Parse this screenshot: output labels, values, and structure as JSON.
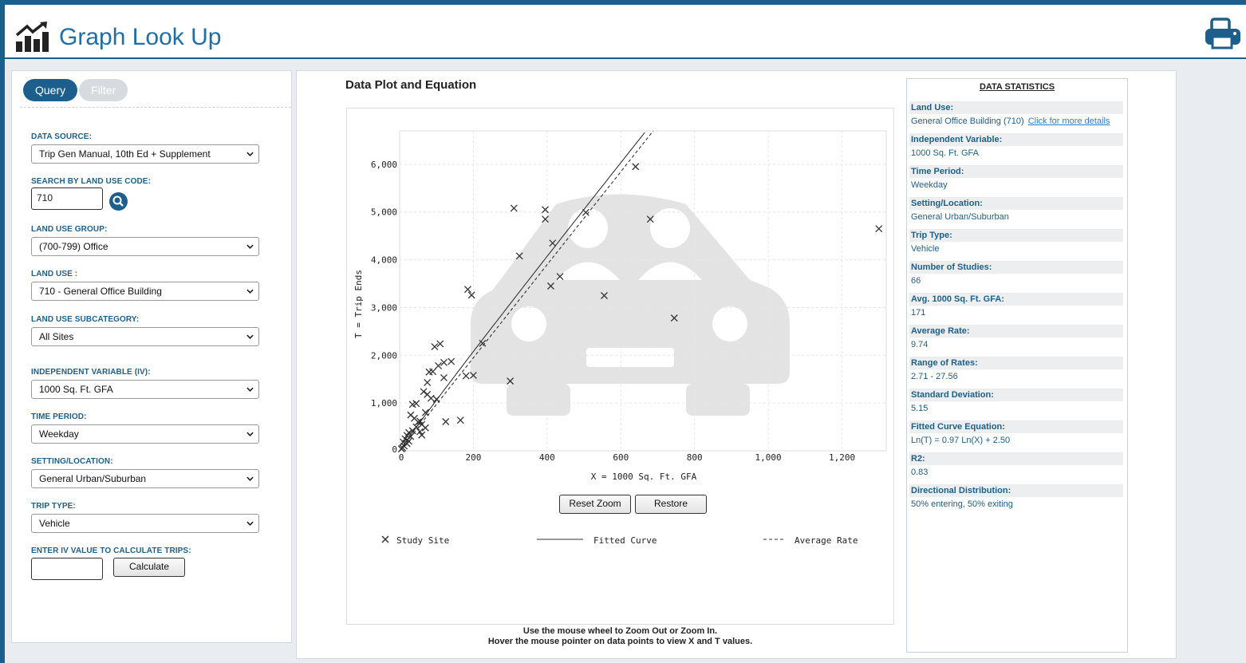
{
  "app": {
    "title": "Graph Look Up"
  },
  "tabs": {
    "query": "Query",
    "filter": "Filter"
  },
  "form": {
    "data_source": {
      "label": "DATA SOURCE:",
      "value": "Trip Gen Manual, 10th Ed + Supplement"
    },
    "search_code": {
      "label": "SEARCH BY LAND USE CODE:",
      "value": "710"
    },
    "land_use_group": {
      "label": "LAND USE GROUP:",
      "value": "(700-799) Office"
    },
    "land_use": {
      "label": "LAND USE :",
      "value": "710 - General Office Building"
    },
    "subcategory": {
      "label": "LAND USE SUBCATEGORY:",
      "value": "All Sites"
    },
    "iv": {
      "label": "INDEPENDENT VARIABLE (IV):",
      "value": "1000 Sq. Ft. GFA"
    },
    "time_period": {
      "label": "TIME PERIOD:",
      "value": "Weekday"
    },
    "setting": {
      "label": "SETTING/LOCATION:",
      "value": "General Urban/Suburban"
    },
    "trip_type": {
      "label": "TRIP TYPE:",
      "value": "Vehicle"
    },
    "iv_value": {
      "label": "ENTER IV VALUE TO CALCULATE TRIPS:",
      "value": ""
    },
    "calculate": "Calculate"
  },
  "plot": {
    "title": "Data Plot and Equation",
    "reset_zoom": "Reset Zoom",
    "restore": "Restore",
    "legend": {
      "study_site": "Study Site",
      "fitted_curve": "Fitted Curve",
      "average_rate": "Average Rate"
    },
    "hint1": "Use the mouse wheel to Zoom Out or Zoom In.",
    "hint2": "Hover the mouse pointer on data points to view X and T values."
  },
  "chart_data": {
    "type": "scatter",
    "xlabel": "X = 1000 Sq. Ft. GFA",
    "ylabel": "T = Trip Ends",
    "xlim": [
      0,
      1320
    ],
    "ylim": [
      0,
      6700
    ],
    "xticks": [
      0,
      200,
      400,
      600,
      800,
      1000,
      1200
    ],
    "xtick_labels": [
      "0",
      "200",
      "400",
      "600",
      "800",
      "1,000",
      "1,200"
    ],
    "yticks": [
      0,
      1000,
      2000,
      3000,
      4000,
      5000,
      6000
    ],
    "ytick_labels": [
      "0",
      "1,000",
      "2,000",
      "3,000",
      "4,000",
      "5,000",
      "6,000"
    ],
    "grid": true,
    "series": [
      {
        "name": "Study Site",
        "marker": "x",
        "points": [
          [
            1300,
            4650
          ],
          [
            640,
            5950
          ],
          [
            680,
            4850
          ],
          [
            310,
            5080
          ],
          [
            395,
            5050
          ],
          [
            395,
            4850
          ],
          [
            415,
            4350
          ],
          [
            505,
            4990
          ],
          [
            325,
            4080
          ],
          [
            435,
            3650
          ],
          [
            410,
            3450
          ],
          [
            555,
            3250
          ],
          [
            745,
            2780
          ],
          [
            185,
            3380
          ],
          [
            195,
            3260
          ],
          [
            225,
            2250
          ],
          [
            180,
            1570
          ],
          [
            200,
            1580
          ],
          [
            300,
            1460
          ],
          [
            165,
            640
          ],
          [
            125,
            610
          ],
          [
            95,
            2180
          ],
          [
            110,
            2240
          ],
          [
            120,
            1850
          ],
          [
            140,
            1870
          ],
          [
            105,
            1780
          ],
          [
            90,
            1660
          ],
          [
            80,
            1650
          ],
          [
            120,
            1530
          ],
          [
            75,
            1430
          ],
          [
            65,
            1240
          ],
          [
            75,
            1180
          ],
          [
            100,
            1080
          ],
          [
            85,
            1100
          ],
          [
            35,
            970
          ],
          [
            45,
            990
          ],
          [
            70,
            800
          ],
          [
            30,
            750
          ],
          [
            40,
            680
          ],
          [
            50,
            600
          ],
          [
            60,
            550
          ],
          [
            45,
            500
          ],
          [
            35,
            420
          ],
          [
            55,
            400
          ],
          [
            25,
            380
          ],
          [
            20,
            320
          ],
          [
            30,
            300
          ],
          [
            15,
            250
          ],
          [
            10,
            180
          ],
          [
            20,
            150
          ],
          [
            12,
            100
          ],
          [
            8,
            60
          ],
          [
            5,
            40
          ],
          [
            25,
            200
          ],
          [
            60,
            330
          ],
          [
            70,
            480
          ],
          [
            55,
            620
          ]
        ]
      },
      {
        "name": "Fitted Curve",
        "equation": "Ln(T) = 0.97 Ln(X) + 2.50",
        "style": "solid"
      },
      {
        "name": "Average Rate",
        "rate": 9.74,
        "style": "dashed"
      }
    ]
  },
  "stats": {
    "title": "DATA STATISTICS",
    "items": [
      {
        "label": "Land Use:",
        "value": "General Office Building (710)",
        "link": "Click for more details"
      },
      {
        "label": "Independent Variable:",
        "value": "1000 Sq. Ft. GFA"
      },
      {
        "label": "Time Period:",
        "value": "Weekday"
      },
      {
        "label": "Setting/Location:",
        "value": "General Urban/Suburban"
      },
      {
        "label": "Trip Type:",
        "value": "Vehicle"
      },
      {
        "label": "Number of Studies:",
        "value": "66"
      },
      {
        "label": "Avg. 1000 Sq. Ft. GFA:",
        "value": "171"
      },
      {
        "label": "Average Rate:",
        "value": "9.74"
      },
      {
        "label": "Range of Rates:",
        "value": "2.71 - 27.56"
      },
      {
        "label": "Standard Deviation:",
        "value": "5.15"
      },
      {
        "label": "Fitted Curve Equation:",
        "value": "Ln(T) = 0.97 Ln(X) + 2.50"
      },
      {
        "label": "R2:",
        "value": "0.83"
      },
      {
        "label": "Directional Distribution:",
        "value": "50% entering, 50% exiting"
      }
    ]
  },
  "colors": {
    "brand": "#1d5f8c",
    "title": "#1e6fa6",
    "link": "#2a7fd4"
  }
}
